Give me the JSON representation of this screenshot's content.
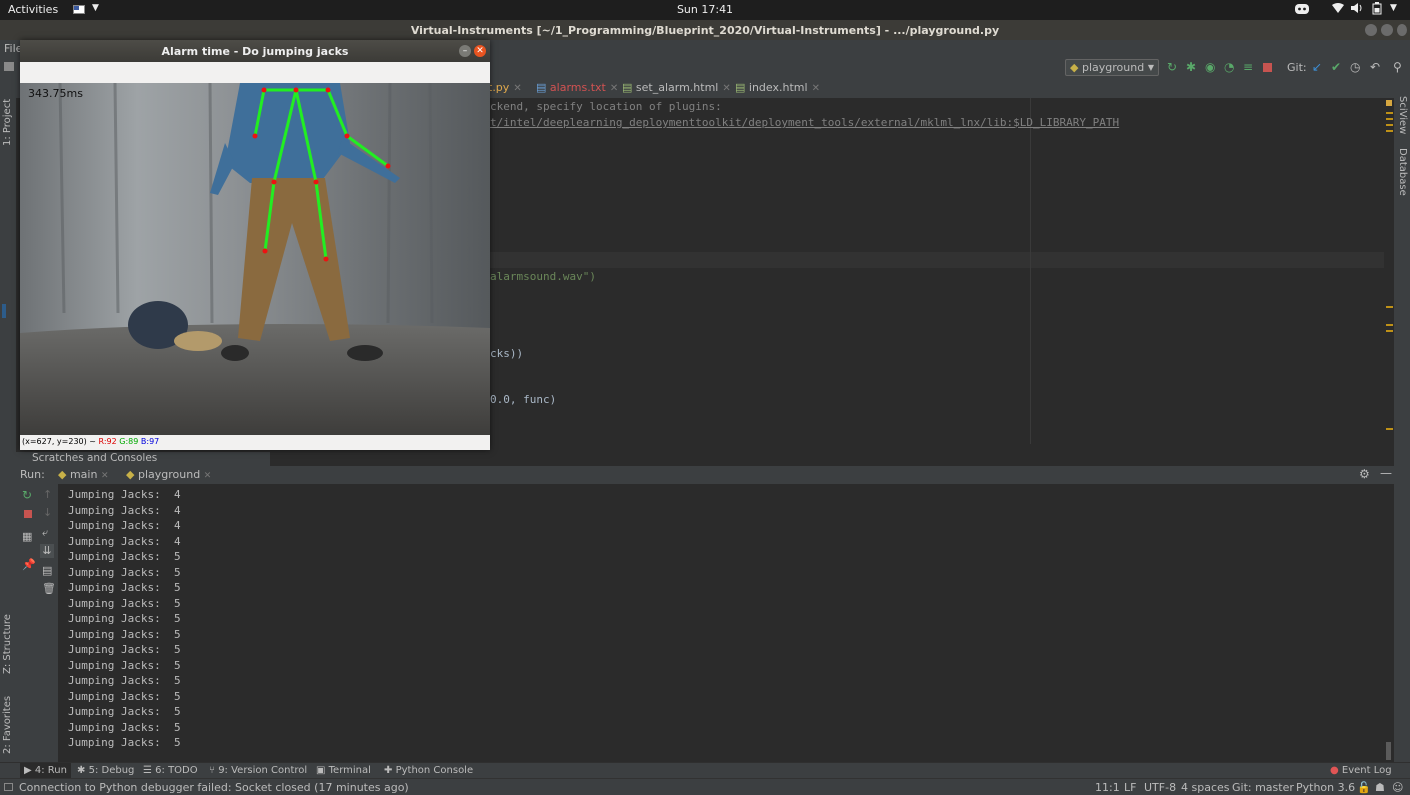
{
  "topbar": {
    "activities": "Activities",
    "clock": "Sun 17:41"
  },
  "window": {
    "title": "Virtual-Instruments [~/1_Programming/Blueprint_2020/Virtual-Instruments] - .../playground.py",
    "menu_partial": "File"
  },
  "toolbar": {
    "run_config": "playground",
    "git_label": "Git:"
  },
  "tabs": [
    {
      "label": "t.py",
      "color": "#e0a94d"
    },
    {
      "label": "alarms.txt",
      "color": "#d25252"
    },
    {
      "label": "set_alarm.html",
      "color": "#bbbbbb"
    },
    {
      "label": "index.html",
      "color": "#bbbbbb"
    }
  ],
  "editor": {
    "lines": [
      {
        "text": "ckend, specify location of plugins:",
        "color": "#808080"
      },
      {
        "text": "t/intel/deeplearning_deploymenttoolkit/deployment_tools/external/mklml_lnx/lib:$LD_LIBRARY_PATH",
        "color": "#808080"
      },
      {
        "text": "alarmsound.wav\")",
        "color": "#6a8759"
      },
      {
        "text": "cks))",
        "color": "#a9b7c6"
      },
      {
        "text": "0.0, func)",
        "color": "#a9b7c6"
      }
    ]
  },
  "left_strip": {
    "project": "1: Project",
    "structure": "Z: Structure",
    "favorites": "2: Favorites"
  },
  "right_strip": {
    "sciview": "SciView",
    "database": "Database"
  },
  "run_panel": {
    "scratches": "Scratches and Consoles",
    "run_label": "Run:",
    "tabs": [
      "main",
      "playground"
    ],
    "console_lines": [
      "Jumping Jacks:  4",
      "Jumping Jacks:  4",
      "Jumping Jacks:  4",
      "Jumping Jacks:  4",
      "Jumping Jacks:  5",
      "Jumping Jacks:  5",
      "Jumping Jacks:  5",
      "Jumping Jacks:  5",
      "Jumping Jacks:  5",
      "Jumping Jacks:  5",
      "Jumping Jacks:  5",
      "Jumping Jacks:  5",
      "Jumping Jacks:  5",
      "Jumping Jacks:  5",
      "Jumping Jacks:  5",
      "Jumping Jacks:  5",
      "Jumping Jacks:  5"
    ]
  },
  "tool_windows": [
    "4: Run",
    "5: Debug",
    "6: TODO",
    "9: Version Control",
    "Terminal",
    "Python Console"
  ],
  "event_log": "Event Log",
  "status": {
    "message": "Connection to Python debugger failed: Socket closed (17 minutes ago)",
    "position": "11:1",
    "line_sep": "LF",
    "encoding": "UTF-8",
    "indent": "4 spaces",
    "git": "Git: master",
    "interpreter": "Python 3.6"
  },
  "cv_window": {
    "title": "Alarm time - Do jumping jacks",
    "latency": "343.75ms",
    "pixel_info": "(x=627, y=230) ~",
    "r": "R:92",
    "g": "G:89",
    "b": "B:97"
  },
  "colors": {
    "skeleton": "#22ee22",
    "joint": "#ee1111"
  }
}
